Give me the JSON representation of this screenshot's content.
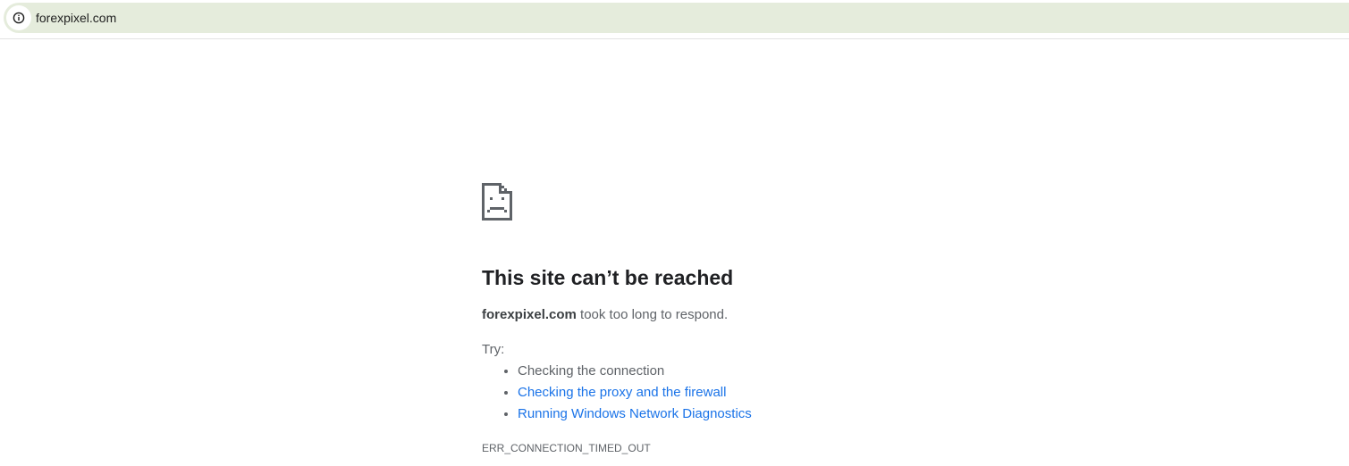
{
  "address_bar": {
    "url": "forexpixel.com",
    "info_icon": "info-icon",
    "background": "#e5ecdc"
  },
  "error_page": {
    "icon": "sad-page-icon",
    "heading": "This site can’t be reached",
    "host": "forexpixel.com",
    "message_rest": " took too long to respond.",
    "try_label": "Try:",
    "suggestions": [
      {
        "label": "Checking the connection",
        "is_link": false
      },
      {
        "label": "Checking the proxy and the firewall",
        "is_link": true
      },
      {
        "label": "Running Windows Network Diagnostics",
        "is_link": true
      }
    ],
    "error_code": "ERR_CONNECTION_TIMED_OUT"
  },
  "colors": {
    "heading": "#202124",
    "text": "#5f6368",
    "link": "#1a73e8"
  }
}
